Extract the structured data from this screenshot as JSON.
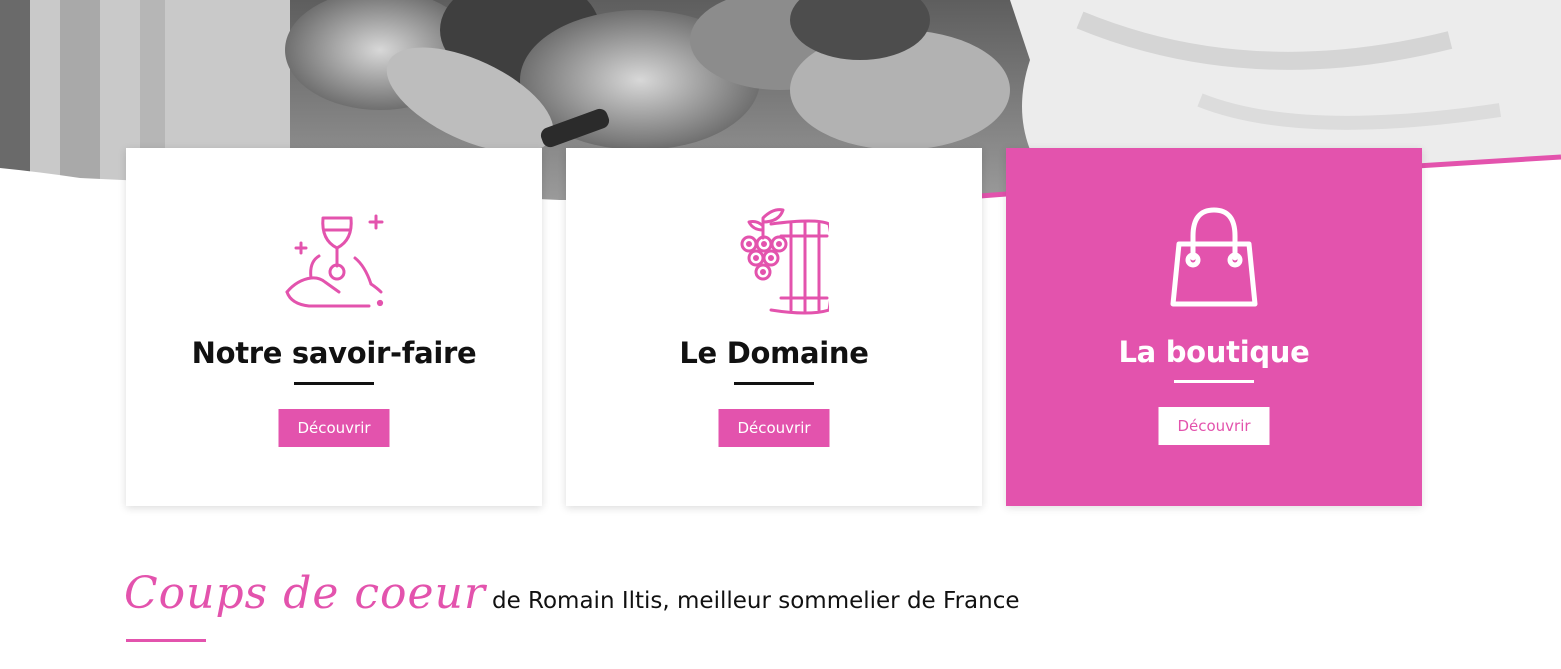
{
  "brand": {
    "accent": "#e353ad",
    "text": "#111111"
  },
  "cards": [
    {
      "icon": "wine-tasting-icon",
      "title": "Notre savoir-faire",
      "button": "Découvrir"
    },
    {
      "icon": "grapes-barrel-icon",
      "title": "Le Domaine",
      "button": "Découvrir"
    },
    {
      "icon": "shopping-bag-icon",
      "title": "La boutique",
      "button": "Découvrir"
    }
  ],
  "coups": {
    "script_title": "Coups de coeur",
    "subtitle": "de Romain Iltis, meilleur sommelier de France"
  }
}
